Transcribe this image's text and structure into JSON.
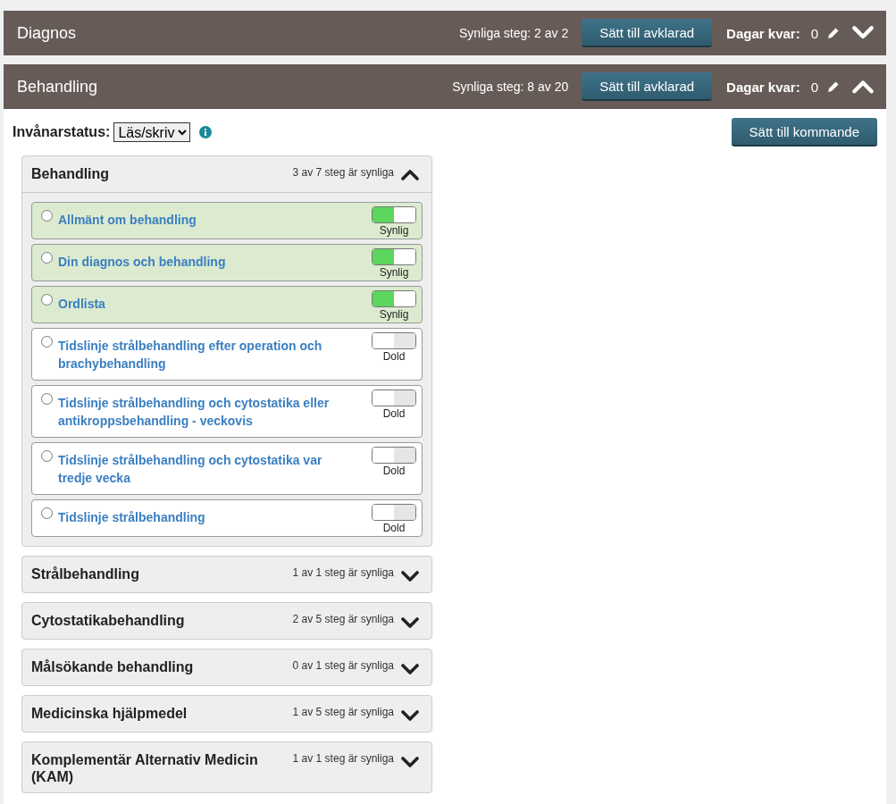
{
  "sections": [
    {
      "title": "Diagnos",
      "visible_steps": "Synliga steg: 2 av 2",
      "done_button": "Sätt till avklarad",
      "days_label": "Dagar kvar:",
      "days_value": "0",
      "expanded": false
    },
    {
      "title": "Behandling",
      "visible_steps": "Synliga steg: 8 av 20",
      "done_button": "Sätt till avklarad",
      "days_label": "Dagar kvar:",
      "days_value": "0",
      "expanded": true,
      "status": {
        "label": "Invånarstatus:",
        "value": "Läs/skriv"
      },
      "next_button": "Sätt till kommande",
      "groups": [
        {
          "title": "Behandling",
          "count": "3 av 7 steg är synliga",
          "expanded": true,
          "steps": [
            {
              "title": "Allmänt om behandling",
              "selected": false,
              "visible": true,
              "state_label": "Synlig"
            },
            {
              "title": "Din diagnos och behandling",
              "selected": false,
              "visible": true,
              "state_label": "Synlig"
            },
            {
              "title": "Ordlista",
              "selected": false,
              "visible": true,
              "state_label": "Synlig"
            },
            {
              "title": "Tidslinje strålbehandling efter operation och brachybehandling",
              "selected": false,
              "visible": false,
              "state_label": "Dold"
            },
            {
              "title": "Tidslinje strålbehandling och cytostatika eller antikroppsbehandling - veckovis",
              "selected": false,
              "visible": false,
              "state_label": "Dold"
            },
            {
              "title": "Tidslinje strålbehandling och cytostatika var tredje vecka",
              "selected": false,
              "visible": false,
              "state_label": "Dold"
            },
            {
              "title": "Tidslinje strålbehandling",
              "selected": false,
              "visible": false,
              "state_label": "Dold"
            }
          ]
        },
        {
          "title": "Strålbehandling",
          "count": "1 av 1 steg är synliga",
          "expanded": false
        },
        {
          "title": "Cytostatikabehandling",
          "count": "2 av 5 steg är synliga",
          "expanded": false
        },
        {
          "title": "Målsökande behandling",
          "count": "0 av 1 steg är synliga",
          "expanded": false
        },
        {
          "title": "Medicinska hjälpmedel",
          "count": "1 av 5 steg är synliga",
          "expanded": false
        },
        {
          "title": "Komplementär Alternativ Medicin (KAM)",
          "count": "1 av 1 steg är synliga",
          "expanded": false
        }
      ]
    }
  ]
}
